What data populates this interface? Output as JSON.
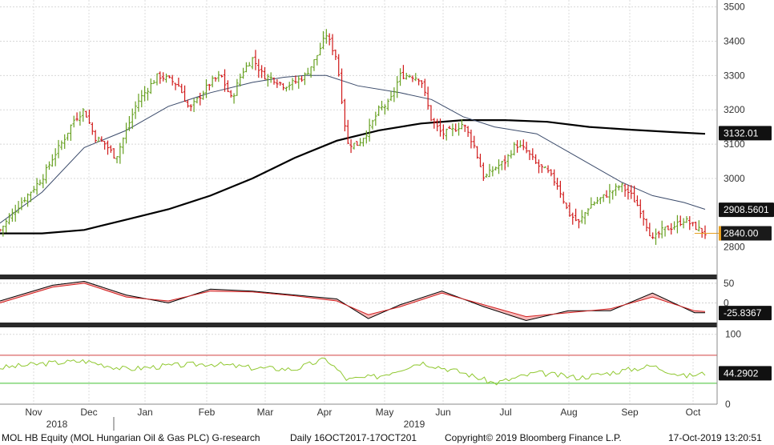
{
  "chart_data": {
    "type": "line",
    "instrument": "MOL HB Equity (MOL Hungarian Oil & Gas PLC) G-research",
    "period": "Daily 16OCT2017-17OCT201",
    "copyright": "Copyright© 2019 Bloomberg Finance L.P.",
    "timestamp": "17-Oct-2019 13:20:51",
    "x_months": [
      "Nov",
      "Dec",
      "Jan",
      "Feb",
      "Mar",
      "Apr",
      "May",
      "Jun",
      "Jul",
      "Aug",
      "Sep",
      "Oct"
    ],
    "x_years": [
      "2018",
      "2019"
    ],
    "price_panel": {
      "ylim": [
        2720,
        3520
      ],
      "y_ticks": [
        "3500",
        "3400",
        "3300",
        "3200",
        "3100",
        "3000",
        "2800"
      ],
      "close_points": [
        [
          0,
          2850
        ],
        [
          2,
          2930
        ],
        [
          4,
          3000
        ],
        [
          5,
          3060
        ],
        [
          6,
          3110
        ],
        [
          7,
          3170
        ],
        [
          8,
          3200
        ],
        [
          9,
          3120
        ],
        [
          10,
          3100
        ],
        [
          11,
          3060
        ],
        [
          12,
          3140
        ],
        [
          13,
          3220
        ],
        [
          14,
          3260
        ],
        [
          15,
          3300
        ],
        [
          16,
          3290
        ],
        [
          17,
          3270
        ],
        [
          18,
          3200
        ],
        [
          19,
          3240
        ],
        [
          20,
          3280
        ],
        [
          21,
          3300
        ],
        [
          22,
          3230
        ],
        [
          23,
          3310
        ],
        [
          24,
          3350
        ],
        [
          25,
          3300
        ],
        [
          26,
          3290
        ],
        [
          27,
          3270
        ],
        [
          28,
          3280
        ],
        [
          29,
          3300
        ],
        [
          30,
          3350
        ],
        [
          31,
          3420
        ],
        [
          32,
          3350
        ],
        [
          33,
          3100
        ],
        [
          34,
          3100
        ],
        [
          35,
          3140
        ],
        [
          36,
          3200
        ],
        [
          37,
          3220
        ],
        [
          38,
          3300
        ],
        [
          39,
          3300
        ],
        [
          40,
          3290
        ],
        [
          41,
          3170
        ],
        [
          42,
          3130
        ],
        [
          43,
          3140
        ],
        [
          44,
          3160
        ],
        [
          45,
          3100
        ],
        [
          46,
          3000
        ],
        [
          47,
          3030
        ],
        [
          48,
          3050
        ],
        [
          49,
          3100
        ],
        [
          50,
          3080
        ],
        [
          51,
          3040
        ],
        [
          52,
          3020
        ],
        [
          53,
          2980
        ],
        [
          54,
          2900
        ],
        [
          55,
          2870
        ],
        [
          56,
          2920
        ],
        [
          57,
          2940
        ],
        [
          58,
          2960
        ],
        [
          59,
          2980
        ],
        [
          60,
          2950
        ],
        [
          61,
          2900
        ],
        [
          62,
          2820
        ],
        [
          63,
          2850
        ],
        [
          64,
          2860
        ],
        [
          65,
          2880
        ],
        [
          66,
          2860
        ],
        [
          67,
          2840
        ]
      ],
      "ma_short": [
        [
          0,
          2870
        ],
        [
          4,
          2960
        ],
        [
          8,
          3090
        ],
        [
          12,
          3140
        ],
        [
          16,
          3210
        ],
        [
          20,
          3250
        ],
        [
          24,
          3280
        ],
        [
          27,
          3295
        ],
        [
          29,
          3300
        ],
        [
          31,
          3300
        ],
        [
          34,
          3270
        ],
        [
          38,
          3250
        ],
        [
          41,
          3230
        ],
        [
          44,
          3180
        ],
        [
          47,
          3150
        ],
        [
          51,
          3130
        ],
        [
          55,
          3060
        ],
        [
          59,
          2990
        ],
        [
          62,
          2950
        ],
        [
          65,
          2930
        ],
        [
          67,
          2910
        ]
      ],
      "ma_long": [
        [
          0,
          2840
        ],
        [
          4,
          2840
        ],
        [
          8,
          2850
        ],
        [
          12,
          2880
        ],
        [
          16,
          2910
        ],
        [
          20,
          2950
        ],
        [
          24,
          3000
        ],
        [
          28,
          3060
        ],
        [
          32,
          3110
        ],
        [
          36,
          3140
        ],
        [
          40,
          3160
        ],
        [
          44,
          3170
        ],
        [
          48,
          3170
        ],
        [
          52,
          3165
        ],
        [
          56,
          3150
        ],
        [
          60,
          3142
        ],
        [
          64,
          3135
        ],
        [
          67,
          3130
        ]
      ],
      "labels": [
        {
          "text": "3132.01",
          "value": 3132.01,
          "bg": "#111111",
          "fg": "#ffffff"
        },
        {
          "text": "2908.5601",
          "value": 2908.56,
          "bg": "#111111",
          "fg": "#ffffff"
        },
        {
          "text": "2840.00",
          "value": 2840.0,
          "bg": "#1a1a1a",
          "fg": "#ffffff",
          "accent": "#e8a020"
        }
      ]
    },
    "macd_panel": {
      "ylim": [
        -50,
        60
      ],
      "y_ticks": [
        "50",
        "0"
      ],
      "series_black": [
        [
          0,
          5
        ],
        [
          5,
          45
        ],
        [
          8,
          55
        ],
        [
          12,
          20
        ],
        [
          16,
          0
        ],
        [
          20,
          35
        ],
        [
          24,
          30
        ],
        [
          28,
          20
        ],
        [
          32,
          10
        ],
        [
          35,
          -40
        ],
        [
          38,
          -5
        ],
        [
          42,
          30
        ],
        [
          46,
          -10
        ],
        [
          50,
          -45
        ],
        [
          54,
          -20
        ],
        [
          58,
          -20
        ],
        [
          62,
          25
        ],
        [
          66,
          -25
        ],
        [
          67,
          -25
        ]
      ],
      "series_red": [
        [
          0,
          0
        ],
        [
          5,
          40
        ],
        [
          8,
          50
        ],
        [
          12,
          15
        ],
        [
          16,
          5
        ],
        [
          20,
          30
        ],
        [
          24,
          28
        ],
        [
          28,
          18
        ],
        [
          32,
          5
        ],
        [
          35,
          -30
        ],
        [
          38,
          -10
        ],
        [
          42,
          25
        ],
        [
          46,
          -5
        ],
        [
          50,
          -35
        ],
        [
          54,
          -25
        ],
        [
          58,
          -15
        ],
        [
          62,
          15
        ],
        [
          66,
          -20
        ],
        [
          67,
          -22
        ]
      ],
      "label": {
        "text": "-25.8367",
        "value": -25.8367,
        "bg": "#111111",
        "fg": "#ffffff"
      }
    },
    "rsi_panel": {
      "ylim": [
        0,
        110
      ],
      "y_ticks": [
        "100",
        "0"
      ],
      "upper_line": 70,
      "lower_line": 30,
      "series": [
        [
          0,
          52
        ],
        [
          4,
          58
        ],
        [
          8,
          62
        ],
        [
          12,
          50
        ],
        [
          16,
          55
        ],
        [
          20,
          58
        ],
        [
          24,
          52
        ],
        [
          28,
          50
        ],
        [
          31,
          65
        ],
        [
          33,
          35
        ],
        [
          36,
          40
        ],
        [
          40,
          60
        ],
        [
          44,
          45
        ],
        [
          47,
          30
        ],
        [
          51,
          45
        ],
        [
          55,
          38
        ],
        [
          58,
          45
        ],
        [
          62,
          55
        ],
        [
          65,
          40
        ],
        [
          67,
          44
        ]
      ],
      "label": {
        "text": "44.2902",
        "value": 44.2902,
        "bg": "#111111",
        "fg": "#ffffff"
      }
    },
    "colors": {
      "up": "#66a020",
      "down": "#d01818",
      "ma_short": "#3a4a6a",
      "ma_long": "#000000",
      "macd_fill": "#f08080",
      "rsi_line": "#90c830",
      "rsi_upper": "#d04040",
      "rsi_lower": "#40c030"
    }
  }
}
